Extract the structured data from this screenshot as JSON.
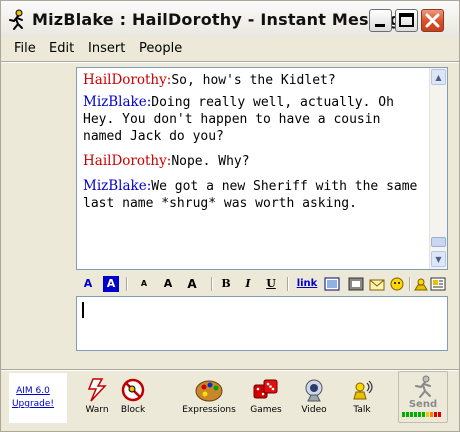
{
  "window": {
    "title": "MizBlake : HailDorothy - Instant Message"
  },
  "menu": [
    "File",
    "Edit",
    "Insert",
    "People"
  ],
  "conversation": [
    {
      "sender": "HailDorothy",
      "separator": ":",
      "text": "So, how's the Kidlet?",
      "color": "#cc0000"
    },
    {
      "sender": "MizBlake",
      "separator": ":",
      "text": "Doing really well, actually. Oh Hey. You don't happen to have a cousin named Jack do you?",
      "color": "#0000cc"
    },
    {
      "sender": "HailDorothy",
      "separator": ":",
      "text": "Nope. Why?",
      "color": "#cc0000"
    },
    {
      "sender": "MizBlake",
      "separator": ":",
      "text": "We got a new Sheriff with the same last name *shrug* was worth asking.",
      "color": "#0000cc"
    }
  ],
  "format_toolbar": {
    "font_color": "A",
    "bg_color": "A",
    "smaller": "A",
    "normal": "A",
    "larger": "A",
    "bold": "B",
    "italic": "I",
    "underline": "U",
    "link": "link"
  },
  "message_input": {
    "value": ""
  },
  "upgrade": {
    "line1": "AIM 6.0",
    "line2": "Upgrade!"
  },
  "actions": {
    "warn": "Warn",
    "block": "Block",
    "expressions": "Expressions",
    "games": "Games",
    "video": "Video",
    "talk": "Talk",
    "send": "Send"
  },
  "icons": {
    "close": "close-icon",
    "minimize": "minimize-icon",
    "maximize": "maximize-icon"
  }
}
